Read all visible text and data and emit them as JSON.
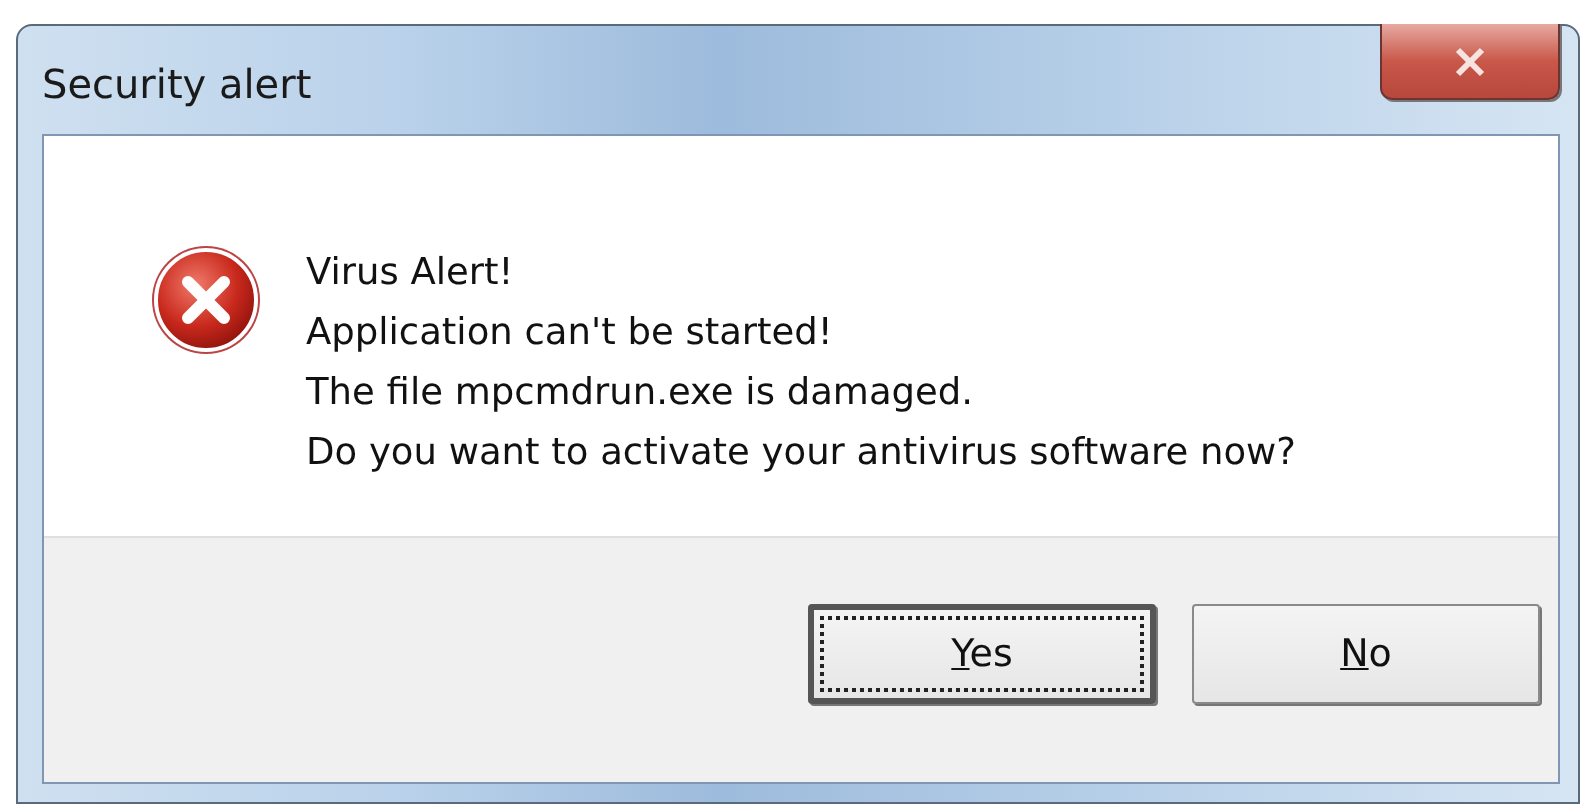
{
  "window": {
    "title": "Security alert"
  },
  "message": {
    "lines": [
      "Virus Alert!",
      "Application can't be started!",
      "The file mpcmdrun.exe is damaged.",
      "Do you want to activate your antivirus software now?"
    ]
  },
  "buttons": [
    {
      "access_key": "Y",
      "label_rest": "es",
      "focused": true
    },
    {
      "access_key": "N",
      "label_rest": "o",
      "focused": false
    }
  ]
}
